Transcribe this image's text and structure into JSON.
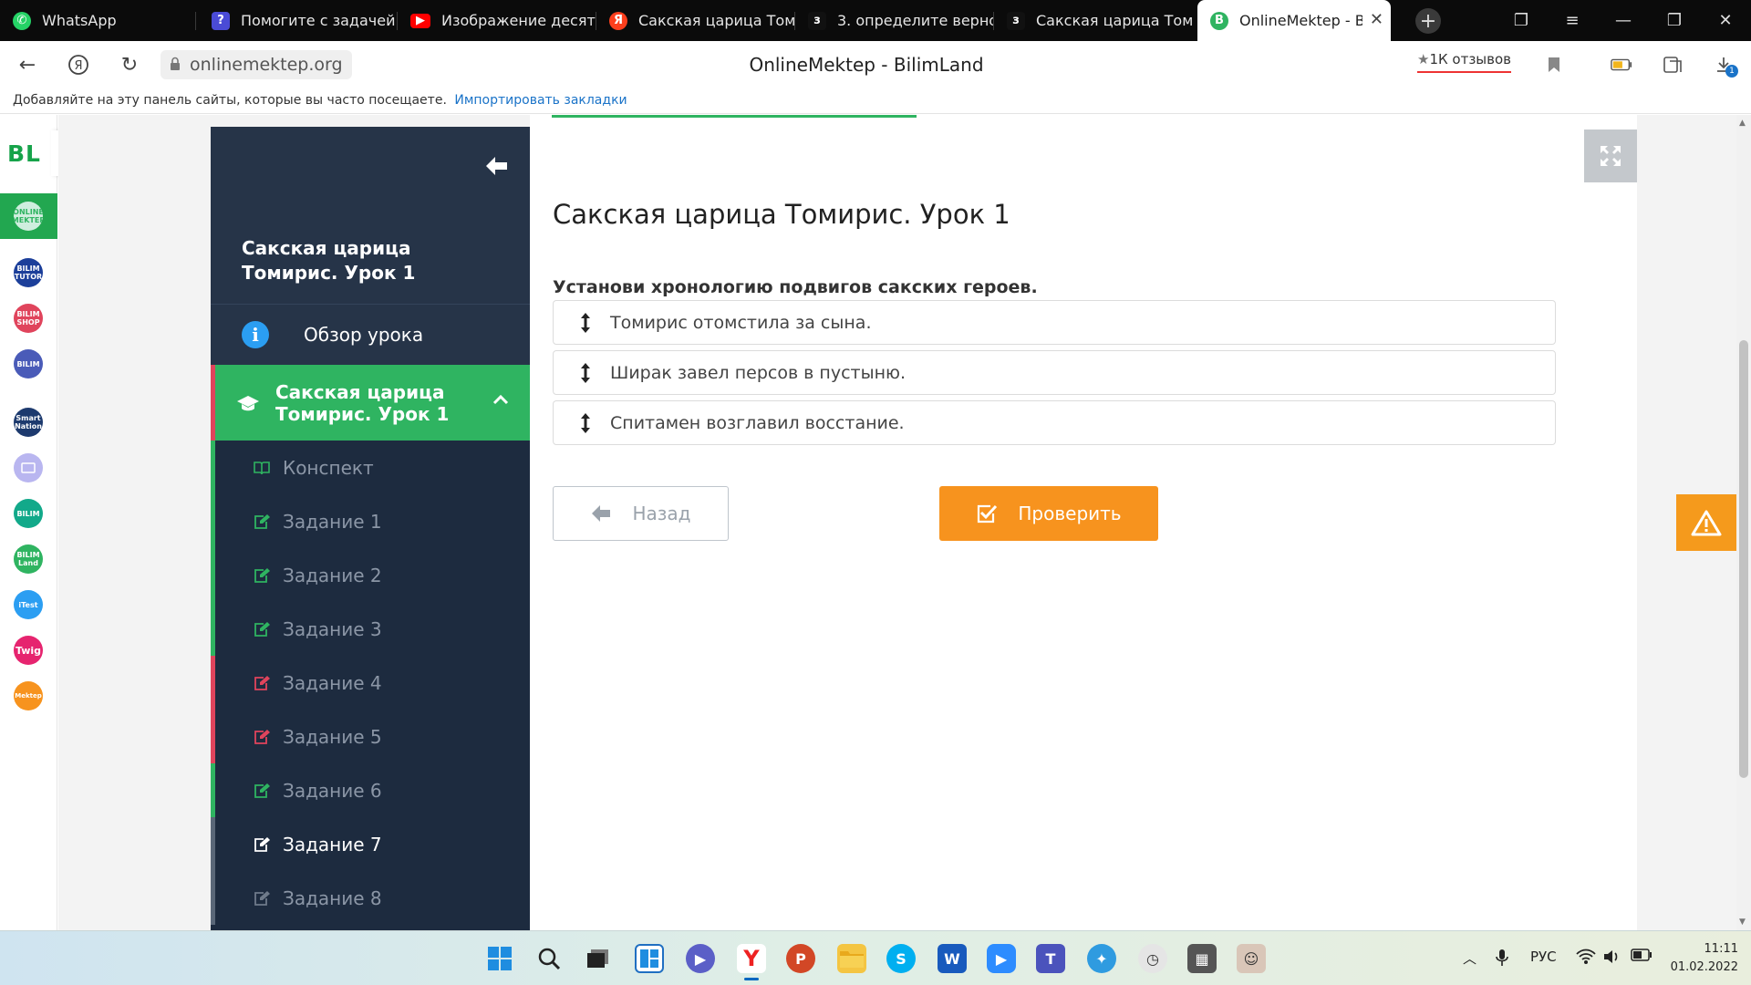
{
  "browser": {
    "tabs": [
      {
        "title": "WhatsApp",
        "icon": "whatsapp-icon",
        "color": "#25d366"
      },
      {
        "title": "Помогите с задачей Г",
        "icon": "question-icon",
        "color": "#4a4bd6"
      },
      {
        "title": "Изображение десяти",
        "icon": "youtube-icon",
        "color": "#ff0000"
      },
      {
        "title": "Сакская царица Томи",
        "icon": "yandex-icon",
        "color": "#fc3f1d"
      },
      {
        "title": "3. определите верно",
        "icon": "znanija-icon",
        "color": "#111111"
      },
      {
        "title": "Сакская царица Томи",
        "icon": "znanija-icon",
        "color": "#111111"
      },
      {
        "title": "OnlineMektep - Bili",
        "icon": "onlinemektep-icon",
        "color": "#2fb461"
      }
    ],
    "url": "onlinemektep.org",
    "page_title": "OnlineMektep - BilimLand",
    "reviews": "1К отзывов",
    "download_badge": "1"
  },
  "bookmarks": {
    "text": "Добавляйте на эту панель сайты, которые вы часто посещаете.",
    "link": "Импортировать закладки"
  },
  "sidebar": {
    "logo": "BL",
    "apps": [
      {
        "name": "onlinemektep",
        "label": "ONLINE MEKTEP",
        "color": "#ffffff"
      },
      {
        "name": "bilim-tutor",
        "label": "BILIM TUTOR",
        "color": "#1c3f9a"
      },
      {
        "name": "bilim-shop",
        "label": "BILIM SHOP",
        "color": "#e0445c"
      },
      {
        "name": "bilim-ambassador",
        "label": "BILIM",
        "color": "#4a5bb8"
      },
      {
        "name": "smart-nation",
        "label": "Smart Nation",
        "color": "#1d3a6e"
      },
      {
        "name": "bilim-tv",
        "label": "",
        "color": "#b9b6f0"
      },
      {
        "name": "bilim-center",
        "label": "BILIM",
        "color": "#12a98a"
      },
      {
        "name": "bilimland",
        "label": "BILIM Land",
        "color": "#2fb461"
      },
      {
        "name": "itest",
        "label": "iTest",
        "color": "#2b9ef2"
      },
      {
        "name": "twig",
        "label": "Twig",
        "color": "#e6246f"
      },
      {
        "name": "mektep",
        "label": "Mektep",
        "color": "#f7931e"
      }
    ]
  },
  "lesson_nav": {
    "title": "Сакская царица Томирис. Урок 1",
    "overview": "Обзор урока",
    "current": "Сакская царица Томирис. Урок 1",
    "items": [
      {
        "label": "Конспект",
        "status": "g"
      },
      {
        "label": "Задание 1",
        "status": "g"
      },
      {
        "label": "Задание 2",
        "status": "g"
      },
      {
        "label": "Задание 3",
        "status": "g"
      },
      {
        "label": "Задание 4",
        "status": "r"
      },
      {
        "label": "Задание 5",
        "status": "r"
      },
      {
        "label": "Задание 6",
        "status": "g"
      },
      {
        "label": "Задание 7",
        "status": "k"
      },
      {
        "label": "Задание 8",
        "status": "k"
      }
    ]
  },
  "content": {
    "lesson_title": "Сакская царица Томирис. Урок 1",
    "question": "Установи хронологию подвигов сакских героев.",
    "order_items": [
      "Томирис отомстила за сына.",
      "Ширак завел персов в пустыню.",
      "Спитамен возглавил восстание."
    ],
    "back_label": "Назад",
    "check_label": "Проверить"
  },
  "taskbar": {
    "lang": "РУС",
    "time": "11:11",
    "date": "01.02.2022"
  },
  "colors": {
    "green": "#2fb461",
    "red": "#e0445c",
    "orange": "#f7931e",
    "nav_bg": "#1d2b3f"
  }
}
